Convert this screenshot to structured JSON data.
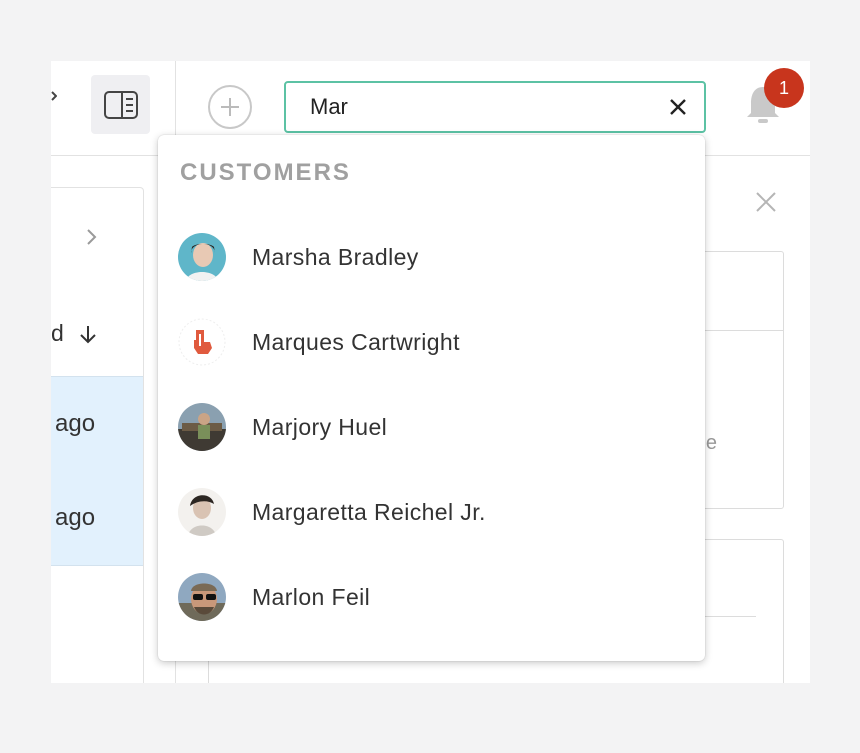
{
  "search": {
    "value": "Mar",
    "placeholder": ""
  },
  "notifications": {
    "count": "1",
    "badge_color": "#c8351d"
  },
  "left_list": {
    "sort_label": "d",
    "rows": [
      "ago",
      "ago"
    ]
  },
  "right_panel": {
    "fragment_text": "e"
  },
  "dropdown": {
    "section_title": "CUSTOMERS",
    "results": [
      {
        "name": "Marsha Bradley",
        "avatar": "person-photo"
      },
      {
        "name": "Marques Cartwright",
        "avatar": "red-hand-logo"
      },
      {
        "name": "Marjory Huel",
        "avatar": "person-photo"
      },
      {
        "name": "Margaretta Reichel Jr.",
        "avatar": "person-photo"
      },
      {
        "name": "Marlon Feil",
        "avatar": "person-photo"
      }
    ]
  },
  "colors": {
    "search_border": "#5cc2a4",
    "selected_row_bg": "#e2f1fd",
    "section_title": "#a0a0a0"
  }
}
